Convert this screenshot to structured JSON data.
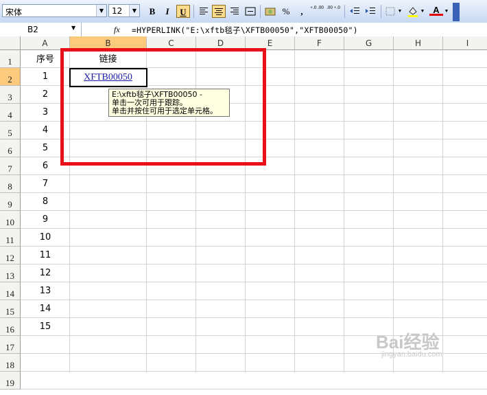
{
  "toolbar": {
    "font_name": "宋体",
    "font_size": "12",
    "bold": "B",
    "italic": "I",
    "underline": "U",
    "percent": "%",
    "comma": ",",
    "inc_decimal": "+.0 .00",
    "dec_decimal": ".00 +.0",
    "font_color_label": "A"
  },
  "formula_bar": {
    "name_box": "B2",
    "fx": "fx",
    "formula": "=HYPERLINK(\"E:\\xftb毯子\\XFTB00050\",\"XFTB00050\")"
  },
  "columns": [
    "A",
    "B",
    "C",
    "D",
    "E",
    "F",
    "G",
    "H",
    "I"
  ],
  "rows": [
    "1",
    "2",
    "3",
    "4",
    "5",
    "6",
    "7",
    "8",
    "9",
    "10",
    "11",
    "12",
    "13",
    "14",
    "15",
    "16",
    "17",
    "18",
    "19"
  ],
  "cells": {
    "A1": "序号",
    "B1": "链接",
    "B2": "XFTB00050",
    "A_values": [
      "1",
      "2",
      "3",
      "4",
      "5",
      "6",
      "7",
      "8",
      "9",
      "10",
      "11",
      "12",
      "13",
      "14",
      "15"
    ]
  },
  "tooltip": {
    "line1": "E:\\xftb毯子\\XFTB00050 -",
    "line2": "单击一次可用于跟踪。",
    "line3": "单击并按住可用于选定单元格。"
  },
  "watermark": {
    "text": "Bai经验",
    "sub": "jingyan.baidu.com"
  },
  "colors": {
    "highlight_box": "#e8101a",
    "selected_header": "#fbca7c",
    "link": "#1a1aa8"
  }
}
